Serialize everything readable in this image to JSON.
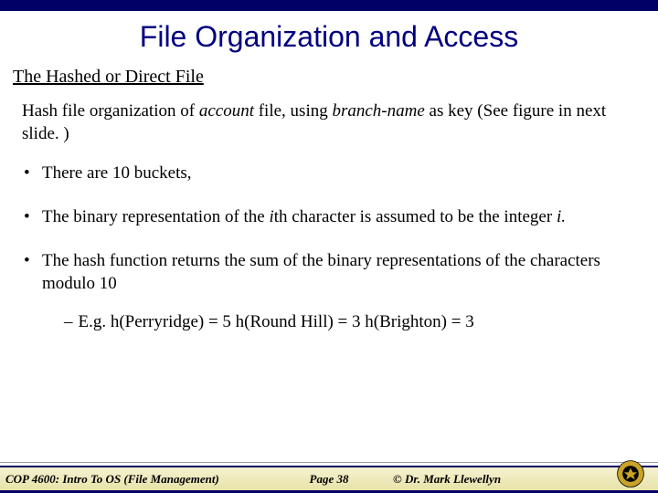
{
  "title": "File Organization and Access",
  "section": "The Hashed or Direct File",
  "intro": {
    "pre": "Hash file organization of ",
    "em1": "account",
    "mid": " file, using ",
    "em2": "branch-name",
    "post": " as key (See figure in next slide. )"
  },
  "bullets": {
    "b1": "There are 10 buckets,",
    "b2_pre": "The binary representation of the ",
    "b2_i": "i",
    "b2_post": "th character is assumed to be the integer ",
    "b2_i2": "i.",
    "b3": "The hash function returns the sum of the binary representations of the characters modulo 10"
  },
  "sub": "E.g. h(Perryridge) = 5    h(Round Hill) = 3   h(Brighton) = 3",
  "footer": {
    "left": "COP 4600: Intro To OS  (File Management)",
    "center": "Page 38",
    "right": "© Dr. Mark Llewellyn"
  }
}
